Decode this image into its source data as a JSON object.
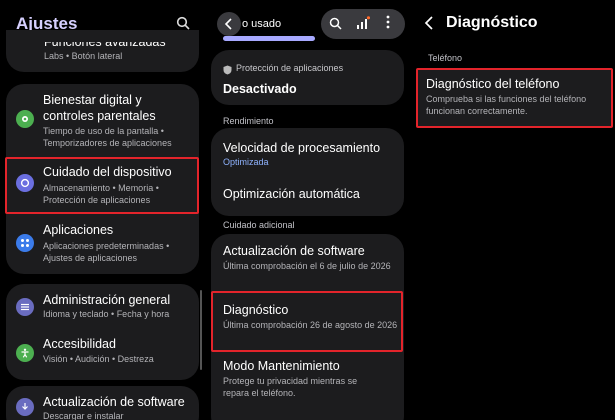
{
  "settings": {
    "title": "Ajustes",
    "items": [
      {
        "title": "Funciones avanzadas",
        "sub": "Labs  •  Botón lateral"
      },
      {
        "title": "Bienestar digital y controles parentales",
        "sub": "Tiempo de uso de la pantalla  •  Temporizadores de aplicaciones"
      },
      {
        "title": "Cuidado del dispositivo",
        "sub": "Almacenamiento  •  Memoria  •  Protección de aplicaciones"
      },
      {
        "title": "Aplicaciones",
        "sub": "Aplicaciones predeterminadas  •  Ajustes de aplicaciones"
      },
      {
        "title": "Administración general",
        "sub": "Idioma y teclado  •  Fecha y hora"
      },
      {
        "title": "Accesibilidad",
        "sub": "Visión  •  Audición  •  Destreza"
      },
      {
        "title": "Actualización de software",
        "sub": "Descargar e instalar"
      }
    ]
  },
  "device_care": {
    "header_partial": "o usado",
    "protection_label": "Protección de aplicaciones",
    "protection_value": "Desactivado",
    "section_performance": "Rendimiento",
    "speed": {
      "title": "Velocidad de procesamiento",
      "sub": "Optimizada"
    },
    "auto_opt": {
      "title": "Optimización automática"
    },
    "section_additional": "Cuidado adicional",
    "update": {
      "title": "Actualización de software",
      "sub": "Última comprobación el 6 de julio de 2026"
    },
    "diagnostics": {
      "title": "Diagnóstico",
      "sub": "Última comprobación 26 de agosto de 2026"
    },
    "maintenance": {
      "title": "Modo Mantenimiento",
      "sub": "Protege tu privacidad mientras se repara el teléfono."
    }
  },
  "diagnostics": {
    "title": "Diagnóstico",
    "section": "Teléfono",
    "item": {
      "title": "Diagnóstico del teléfono",
      "sub": "Comprueba si las funciones del teléfono funcionan correctamente."
    }
  },
  "colors": {
    "highlight": "#e3242b",
    "accent": "#8fb3ff",
    "card": "#1c1c1e"
  }
}
